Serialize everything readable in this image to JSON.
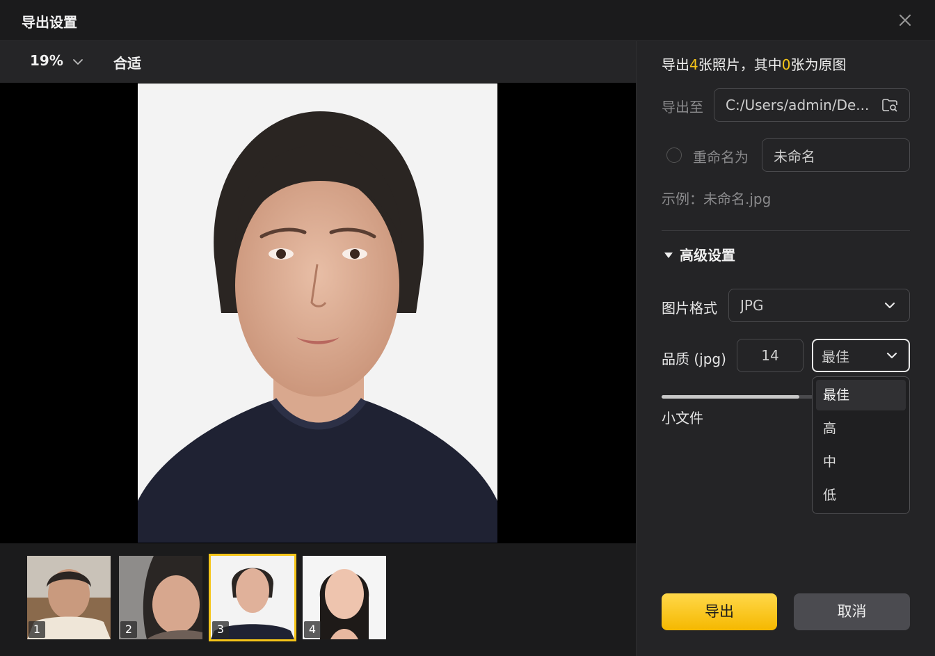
{
  "dialog": {
    "title": "导出设置"
  },
  "toolbar": {
    "zoom": "19%",
    "fit": "合适"
  },
  "thumbnails": [
    {
      "num": "1",
      "selected": false
    },
    {
      "num": "2",
      "selected": false
    },
    {
      "num": "3",
      "selected": true
    },
    {
      "num": "4",
      "selected": false
    }
  ],
  "summary": {
    "prefix": "导出",
    "count": "4",
    "mid": "张照片，其中",
    "original_count": "0",
    "suffix": "张为原图"
  },
  "export_to": {
    "label": "导出至",
    "path": "C:/Users/admin/De..."
  },
  "rename": {
    "label": "重命名为",
    "value": "未命名",
    "checked": false
  },
  "example": "示例：未命名.jpg",
  "advanced": {
    "label": "高级设置"
  },
  "format": {
    "label": "图片格式",
    "value": "JPG"
  },
  "quality": {
    "label": "品质 (jpg)",
    "value": "14",
    "preset": "最佳",
    "options": [
      "最佳",
      "高",
      "中",
      "低"
    ],
    "min_label": "小文件",
    "level": 0.9
  },
  "actions": {
    "export": "导出",
    "cancel": "取消"
  },
  "colors": {
    "accent": "#f5c518",
    "panel": "#242426",
    "canvas": "#000000"
  }
}
